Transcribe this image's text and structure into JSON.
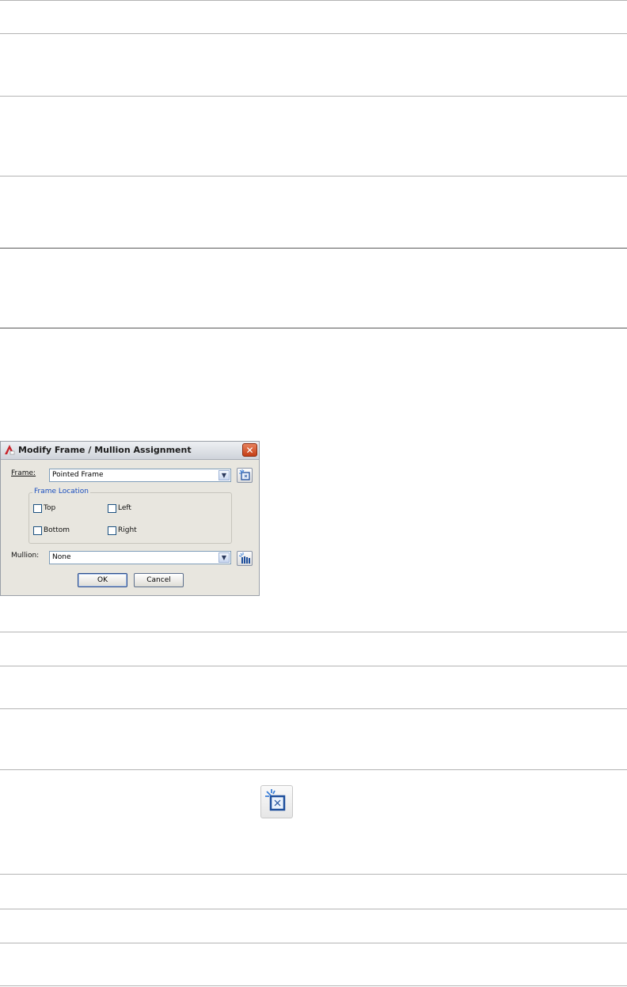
{
  "dialog": {
    "title": "Modify Frame / Mullion Assignment",
    "close_glyph": "✕",
    "frame": {
      "label": "Frame:",
      "value": "Pointed Frame"
    },
    "frame_location": {
      "title": "Frame Location",
      "top": "Top",
      "left": "Left",
      "bottom": "Bottom",
      "right": "Right"
    },
    "mullion": {
      "label": "Mullion:",
      "value": "None"
    },
    "ok_label": "OK",
    "cancel_label": "Cancel"
  },
  "icons": {
    "app": "autocad-app-icon",
    "frame_editor": "edit-frame-icon",
    "mullion_editor": "edit-mullion-icon",
    "combo_arrow": "chevron-down-icon"
  },
  "colors": {
    "dialog_bg": "#e8e6df",
    "close_button": "#d24f24",
    "group_title": "#1b4fbf"
  }
}
